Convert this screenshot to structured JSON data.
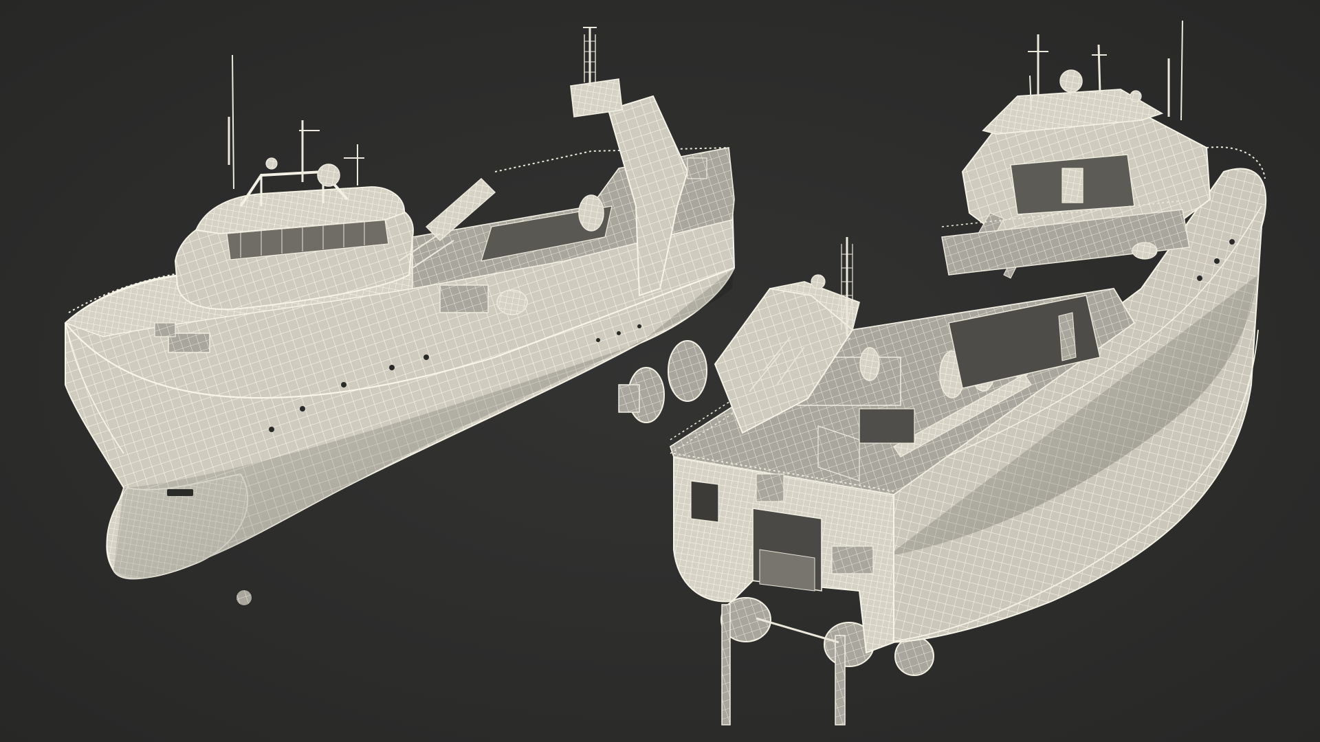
{
  "scene": {
    "background_color": "#2d2d2c",
    "model_color": "#d9d6c8",
    "wire_color": "#fbf8ec",
    "shadow_color": "#8f8d84",
    "views": [
      {
        "id": "bow-view",
        "subject": "fishing-trawler-wireframe"
      },
      {
        "id": "stern-view",
        "subject": "fishing-trawler-wireframe"
      }
    ]
  }
}
